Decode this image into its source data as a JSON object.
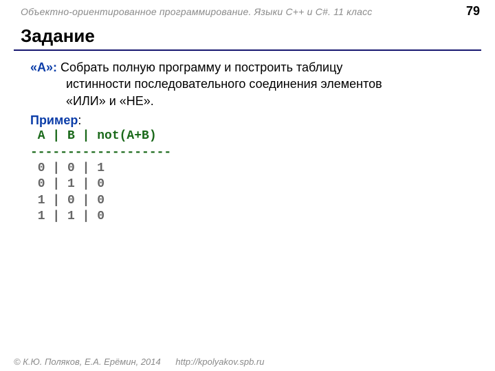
{
  "header": {
    "course_title": "Объектно-ориентированное программирование. Языки C++ и C#. 11 класс",
    "page_number": "79"
  },
  "title": "Задание",
  "task": {
    "label": "«A»:",
    "text_line1": " Собрать полную программу и построить таблицу",
    "text_line2": "истинности последовательного соединения элементов",
    "text_line3": "«ИЛИ» и «НЕ»."
  },
  "example": {
    "label": "Пример",
    "colon": ":",
    "header_row": " A | B | not(A+B)",
    "separator": "-------------------",
    "rows": [
      " 0 | 0 | 1",
      " 0 | 1 | 0",
      " 1 | 0 | 0",
      " 1 | 1 | 0"
    ]
  },
  "footer": {
    "copyright": "© К.Ю. Поляков, Е.А. Ерёмин, 2014",
    "url": "http://kpolyakov.spb.ru"
  }
}
